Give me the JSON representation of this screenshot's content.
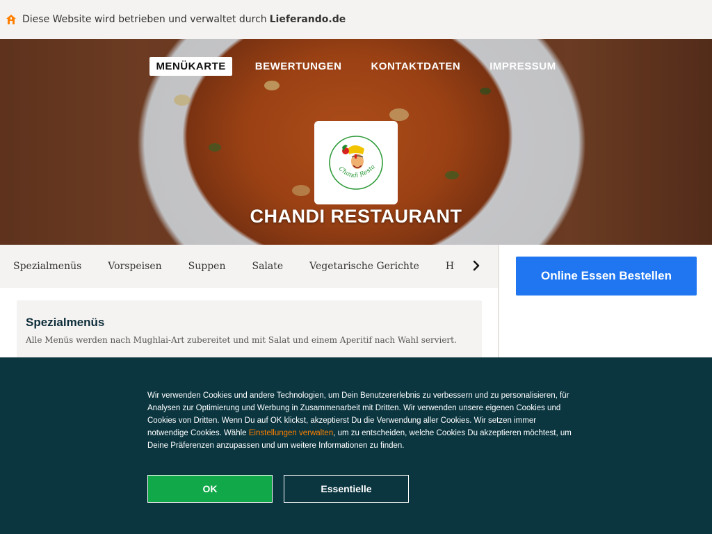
{
  "topbar": {
    "text": "Diese Website wird betrieben und verwaltet durch",
    "brand": "Lieferando.de",
    "icon": "house-icon",
    "icon_color": "#ff8000"
  },
  "nav": {
    "items": [
      {
        "label": "MENÜKARTE",
        "active": true
      },
      {
        "label": "BEWERTUNGEN",
        "active": false
      },
      {
        "label": "KONTAKTDATEN",
        "active": false
      },
      {
        "label": "IMPRESSUM",
        "active": false
      }
    ]
  },
  "restaurant": {
    "name": "CHANDI RESTAURANT",
    "logo_text": "Chandi Restaurant"
  },
  "categories": {
    "items": [
      "Spezialmenüs",
      "Vorspeisen",
      "Suppen",
      "Salate",
      "Vegetarische Gerichte",
      "Hühne"
    ],
    "next_icon": "chevron-right-icon"
  },
  "order": {
    "button_label": "Online Essen Bestellen",
    "button_color": "#1f76f0"
  },
  "menu_section": {
    "title": "Spezialmenüs",
    "description": "Alle Menüs werden nach Mughlai-Art zubereitet und mit Salat und einem Aperitif nach Wahl serviert."
  },
  "cookie": {
    "text_before": "Wir verwenden Cookies und andere Technologien, um Dein Benutzererlebnis zu verbessern und zu personalisieren, für Analysen zur Optimierung und Werbung in Zusammenarbeit mit Dritten. Wir verwenden unsere eigenen Cookies und Cookies von Dritten. Wenn Du auf OK klickst, akzeptierst Du die Verwendung aller Cookies. Wir setzen immer notwendige Cookies. Wähle ",
    "link": "Einstellungen verwalten",
    "text_after": ", um zu entscheiden, welche Cookies Du akzeptieren möchtest, um Deine Präferenzen anzupassen und um weitere Informationen zu finden.",
    "ok_label": "OK",
    "essential_label": "Essentielle",
    "background": "#0b3640",
    "ok_color": "#11a849",
    "link_color": "#ff8000"
  }
}
